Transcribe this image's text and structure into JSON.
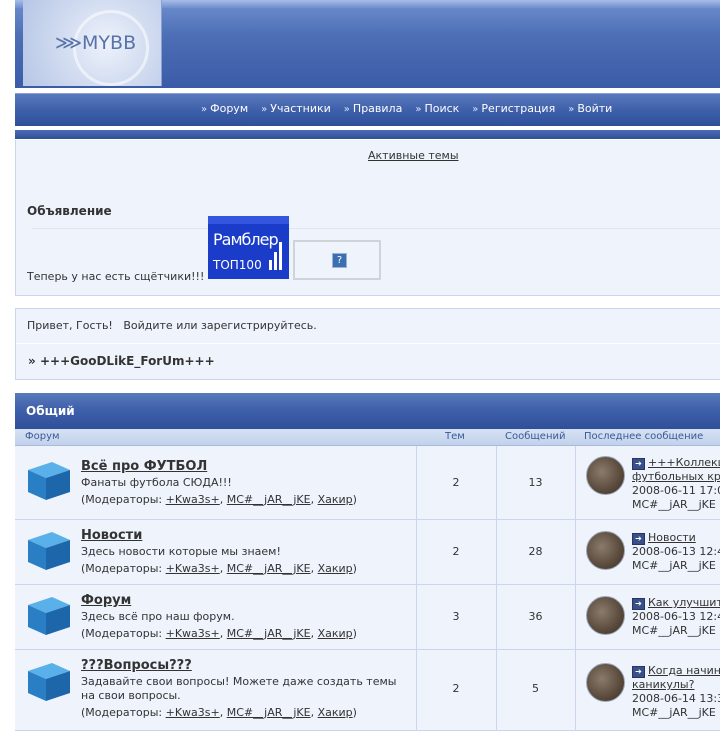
{
  "brand": {
    "logo_text": "MYBB"
  },
  "nav": {
    "items": [
      "Форум",
      "Участники",
      "Правила",
      "Поиск",
      "Регистрация",
      "Войти"
    ],
    "bullet": "»"
  },
  "active_topics": "Активные темы",
  "announcement": {
    "title": "Объявление",
    "text": "Теперь у нас есть сщётчики!!!",
    "counter_line1": "Рамблер",
    "counter_line2": "ТОП100",
    "counter_placeholder": "?"
  },
  "welcome": {
    "prefix": "Привет, Гость!",
    "login_link": "Войдите",
    "middle": "или",
    "register_link": "зарегистрируйтесь",
    "suffix": ".",
    "board_prefix": "»",
    "board_name": "+++GooDLikE_ForUm+++"
  },
  "category": {
    "title": "Общий",
    "columns": {
      "forum": "Форум",
      "topics": "Тем",
      "posts": "Сообщений",
      "last_post": "Последнее сообщение"
    }
  },
  "moderators_label": "(Модераторы:",
  "moderators": [
    "+Kwa3s+",
    "MC#__jAR__jKE",
    "Хакир"
  ],
  "forums": [
    {
      "name": "Всё про ФУТБОЛ",
      "description": "Фанаты футбола СЮДА!!!",
      "topics": "2",
      "posts": "13",
      "last_post": {
        "title_line1": "+++Коллекц",
        "title_line2": "футбольных кр",
        "date": "2008-06-11 17:0",
        "user": "MC#__jAR__jKE"
      }
    },
    {
      "name": "Новости",
      "description": "Здесь новости которые мы знаем!",
      "topics": "2",
      "posts": "28",
      "last_post": {
        "title_line1": "Новости",
        "title_line2": "",
        "date": "2008-06-13 12:4",
        "user": "MC#__jAR__jKE"
      }
    },
    {
      "name": "Форум",
      "description": "Здесь всё про наш форум.",
      "topics": "3",
      "posts": "36",
      "last_post": {
        "title_line1": "Как улучшит",
        "title_line2": "",
        "date": "2008-06-13 12:4",
        "user": "MC#__jAR__jKE"
      }
    },
    {
      "name": "???Вопросы???",
      "description": "Задавайте свои вопросы! Можете даже создать темы на свои вопросы.",
      "topics": "2",
      "posts": "5",
      "last_post": {
        "title_line1": "Когда начин",
        "title_line2": "каникулы?",
        "date": "2008-06-14 13:3",
        "user": "MC#__jAR__jKE"
      }
    }
  ]
}
